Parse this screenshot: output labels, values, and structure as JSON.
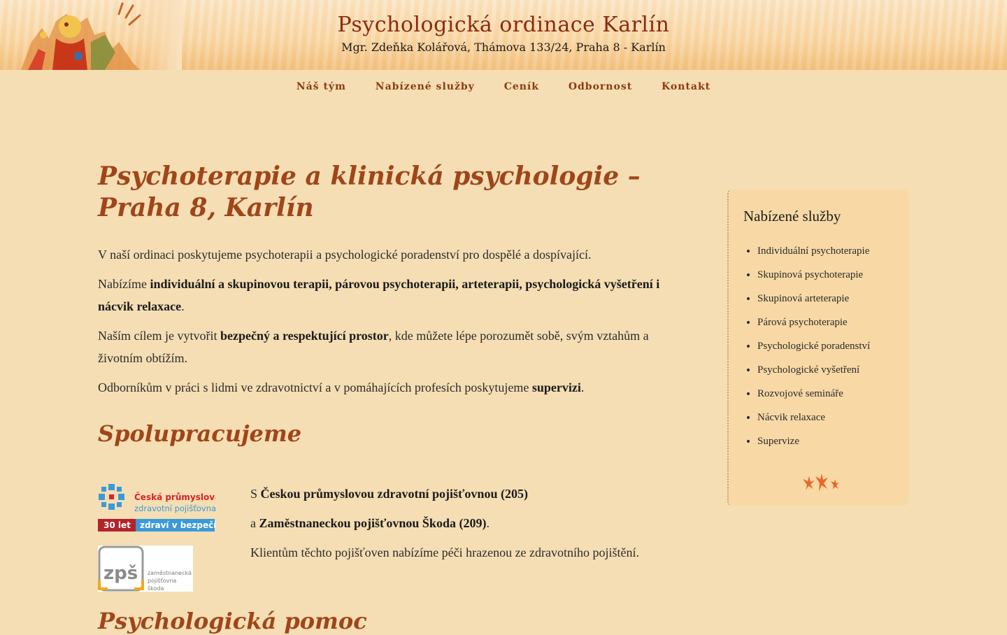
{
  "header": {
    "title": "Psychologická ordinace Karlín",
    "subtitle": "Mgr. Zdeňka Kolářová, Thámova 133/24, Praha 8 - Karlín"
  },
  "nav": [
    "Náš tým",
    "Nabízené služby",
    "Ceník",
    "Odbornost",
    "Kontakt"
  ],
  "main": {
    "heading": "Psychoterapie a klinická psychologie – Praha 8, Karlín",
    "p1": "V naší ordinaci poskytujeme psychoterapii a psychologické poradenství pro dospělé a dospívající.",
    "p2_pre": "Nabízíme ",
    "p2_bold": "individuální a skupinovou terapii, párovou psychoterapii, arteterapii, psychologická vyšetření i nácvik relaxace",
    "p2_post": ".",
    "p3_pre": "Naším cílem je vytvořit ",
    "p3_bold": "bezpečný a respektující prostor",
    "p3_post": ", kde můžete lépe porozumět sobě, svým vztahům a životním obtížím.",
    "p4_pre": "Odborníkům v práci s lidmi ve zdravotnictví a v pomáhajících profesích poskytujeme ",
    "p4_bold": "supervizi",
    "p4_post": ".",
    "coop_heading": "Spolupracujeme",
    "coop_l1_pre": "S ",
    "coop_l1_bold": "Českou průmyslovou zdravotní pojišťovnou (205)",
    "coop_l2_pre": "a ",
    "coop_l2_bold": "Zaměstnaneckou pojišťovnou Škoda (209)",
    "coop_l2_post": ".",
    "coop_l3": "Klientům těchto pojišťoven nabízíme péči hrazenou ze zdravotního pojištění.",
    "next_heading": "Psychologická pomoc"
  },
  "logos": {
    "cpz_line1": "Česká průmyslová",
    "cpz_line2": "zdravotní pojišťovna",
    "cpz_badge1": "30 let",
    "cpz_badge2": "zdraví v bezpečí",
    "zps_mark": "zpš",
    "zps_line1": "zaměstnanecká",
    "zps_line2": "pojišťovna",
    "zps_line3": "škoda"
  },
  "sidebar": {
    "title": "Nabízené služby",
    "items": [
      "Individuální psychoterapie",
      "Skupinová psychoterapie",
      "Skupinová arteterapie",
      "Párová psychoterapie",
      "Psychologické poradenství",
      "Psychologické vyšetření",
      "Rozvojové semináře",
      "Nácvik relaxace",
      "Supervize"
    ]
  },
  "colors": {
    "background": "#f5deb3",
    "accent": "#a0451a",
    "sidebar_bg": "#f8d9a5"
  }
}
